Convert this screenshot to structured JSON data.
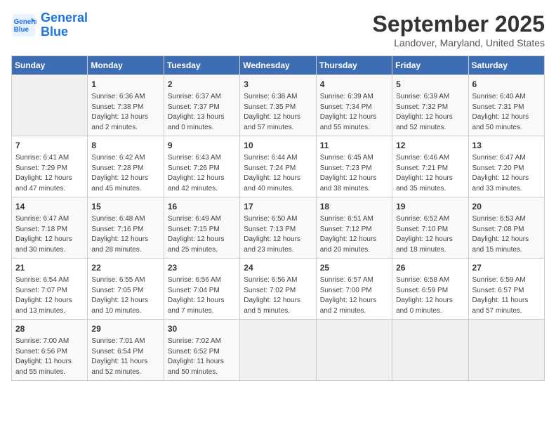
{
  "header": {
    "logo_line1": "General",
    "logo_line2": "Blue",
    "month": "September 2025",
    "location": "Landover, Maryland, United States"
  },
  "days_of_week": [
    "Sunday",
    "Monday",
    "Tuesday",
    "Wednesday",
    "Thursday",
    "Friday",
    "Saturday"
  ],
  "weeks": [
    [
      {
        "day": "",
        "sunrise": "",
        "sunset": "",
        "daylight": ""
      },
      {
        "day": "1",
        "sunrise": "Sunrise: 6:36 AM",
        "sunset": "Sunset: 7:38 PM",
        "daylight": "Daylight: 13 hours and 2 minutes."
      },
      {
        "day": "2",
        "sunrise": "Sunrise: 6:37 AM",
        "sunset": "Sunset: 7:37 PM",
        "daylight": "Daylight: 13 hours and 0 minutes."
      },
      {
        "day": "3",
        "sunrise": "Sunrise: 6:38 AM",
        "sunset": "Sunset: 7:35 PM",
        "daylight": "Daylight: 12 hours and 57 minutes."
      },
      {
        "day": "4",
        "sunrise": "Sunrise: 6:39 AM",
        "sunset": "Sunset: 7:34 PM",
        "daylight": "Daylight: 12 hours and 55 minutes."
      },
      {
        "day": "5",
        "sunrise": "Sunrise: 6:39 AM",
        "sunset": "Sunset: 7:32 PM",
        "daylight": "Daylight: 12 hours and 52 minutes."
      },
      {
        "day": "6",
        "sunrise": "Sunrise: 6:40 AM",
        "sunset": "Sunset: 7:31 PM",
        "daylight": "Daylight: 12 hours and 50 minutes."
      }
    ],
    [
      {
        "day": "7",
        "sunrise": "Sunrise: 6:41 AM",
        "sunset": "Sunset: 7:29 PM",
        "daylight": "Daylight: 12 hours and 47 minutes."
      },
      {
        "day": "8",
        "sunrise": "Sunrise: 6:42 AM",
        "sunset": "Sunset: 7:28 PM",
        "daylight": "Daylight: 12 hours and 45 minutes."
      },
      {
        "day": "9",
        "sunrise": "Sunrise: 6:43 AM",
        "sunset": "Sunset: 7:26 PM",
        "daylight": "Daylight: 12 hours and 42 minutes."
      },
      {
        "day": "10",
        "sunrise": "Sunrise: 6:44 AM",
        "sunset": "Sunset: 7:24 PM",
        "daylight": "Daylight: 12 hours and 40 minutes."
      },
      {
        "day": "11",
        "sunrise": "Sunrise: 6:45 AM",
        "sunset": "Sunset: 7:23 PM",
        "daylight": "Daylight: 12 hours and 38 minutes."
      },
      {
        "day": "12",
        "sunrise": "Sunrise: 6:46 AM",
        "sunset": "Sunset: 7:21 PM",
        "daylight": "Daylight: 12 hours and 35 minutes."
      },
      {
        "day": "13",
        "sunrise": "Sunrise: 6:47 AM",
        "sunset": "Sunset: 7:20 PM",
        "daylight": "Daylight: 12 hours and 33 minutes."
      }
    ],
    [
      {
        "day": "14",
        "sunrise": "Sunrise: 6:47 AM",
        "sunset": "Sunset: 7:18 PM",
        "daylight": "Daylight: 12 hours and 30 minutes."
      },
      {
        "day": "15",
        "sunrise": "Sunrise: 6:48 AM",
        "sunset": "Sunset: 7:16 PM",
        "daylight": "Daylight: 12 hours and 28 minutes."
      },
      {
        "day": "16",
        "sunrise": "Sunrise: 6:49 AM",
        "sunset": "Sunset: 7:15 PM",
        "daylight": "Daylight: 12 hours and 25 minutes."
      },
      {
        "day": "17",
        "sunrise": "Sunrise: 6:50 AM",
        "sunset": "Sunset: 7:13 PM",
        "daylight": "Daylight: 12 hours and 23 minutes."
      },
      {
        "day": "18",
        "sunrise": "Sunrise: 6:51 AM",
        "sunset": "Sunset: 7:12 PM",
        "daylight": "Daylight: 12 hours and 20 minutes."
      },
      {
        "day": "19",
        "sunrise": "Sunrise: 6:52 AM",
        "sunset": "Sunset: 7:10 PM",
        "daylight": "Daylight: 12 hours and 18 minutes."
      },
      {
        "day": "20",
        "sunrise": "Sunrise: 6:53 AM",
        "sunset": "Sunset: 7:08 PM",
        "daylight": "Daylight: 12 hours and 15 minutes."
      }
    ],
    [
      {
        "day": "21",
        "sunrise": "Sunrise: 6:54 AM",
        "sunset": "Sunset: 7:07 PM",
        "daylight": "Daylight: 12 hours and 13 minutes."
      },
      {
        "day": "22",
        "sunrise": "Sunrise: 6:55 AM",
        "sunset": "Sunset: 7:05 PM",
        "daylight": "Daylight: 12 hours and 10 minutes."
      },
      {
        "day": "23",
        "sunrise": "Sunrise: 6:56 AM",
        "sunset": "Sunset: 7:04 PM",
        "daylight": "Daylight: 12 hours and 7 minutes."
      },
      {
        "day": "24",
        "sunrise": "Sunrise: 6:56 AM",
        "sunset": "Sunset: 7:02 PM",
        "daylight": "Daylight: 12 hours and 5 minutes."
      },
      {
        "day": "25",
        "sunrise": "Sunrise: 6:57 AM",
        "sunset": "Sunset: 7:00 PM",
        "daylight": "Daylight: 12 hours and 2 minutes."
      },
      {
        "day": "26",
        "sunrise": "Sunrise: 6:58 AM",
        "sunset": "Sunset: 6:59 PM",
        "daylight": "Daylight: 12 hours and 0 minutes."
      },
      {
        "day": "27",
        "sunrise": "Sunrise: 6:59 AM",
        "sunset": "Sunset: 6:57 PM",
        "daylight": "Daylight: 11 hours and 57 minutes."
      }
    ],
    [
      {
        "day": "28",
        "sunrise": "Sunrise: 7:00 AM",
        "sunset": "Sunset: 6:56 PM",
        "daylight": "Daylight: 11 hours and 55 minutes."
      },
      {
        "day": "29",
        "sunrise": "Sunrise: 7:01 AM",
        "sunset": "Sunset: 6:54 PM",
        "daylight": "Daylight: 11 hours and 52 minutes."
      },
      {
        "day": "30",
        "sunrise": "Sunrise: 7:02 AM",
        "sunset": "Sunset: 6:52 PM",
        "daylight": "Daylight: 11 hours and 50 minutes."
      },
      {
        "day": "",
        "sunrise": "",
        "sunset": "",
        "daylight": ""
      },
      {
        "day": "",
        "sunrise": "",
        "sunset": "",
        "daylight": ""
      },
      {
        "day": "",
        "sunrise": "",
        "sunset": "",
        "daylight": ""
      },
      {
        "day": "",
        "sunrise": "",
        "sunset": "",
        "daylight": ""
      }
    ]
  ]
}
